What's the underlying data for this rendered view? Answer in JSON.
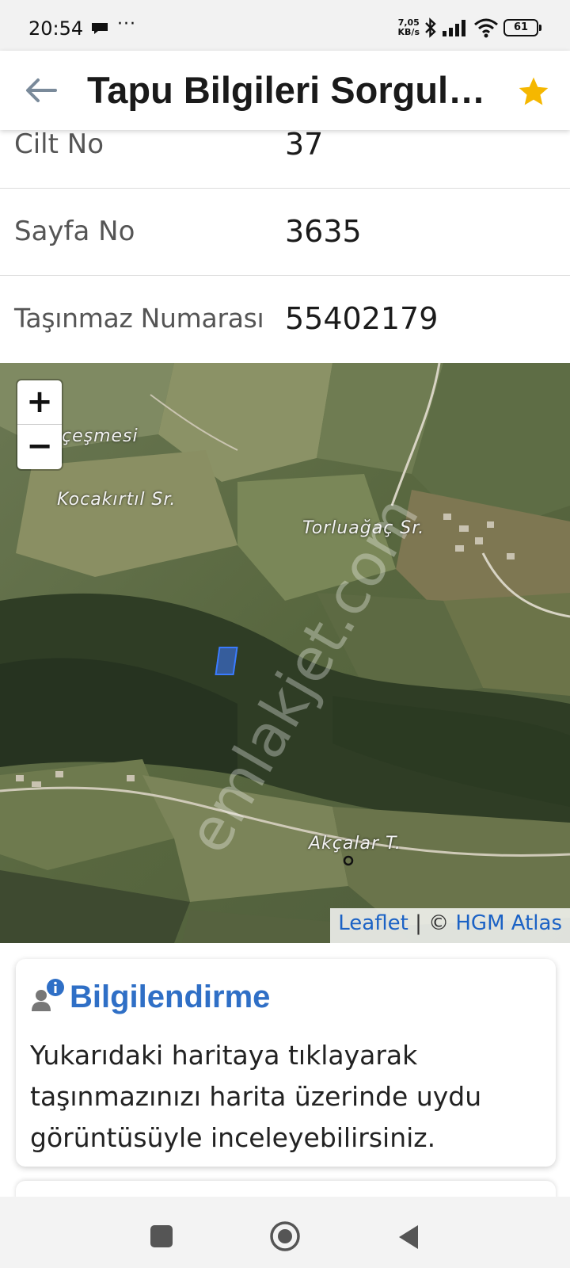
{
  "status_bar": {
    "time": "20:54",
    "dots": "···",
    "net_speed_value": "7,05",
    "net_speed_unit": "KB/s",
    "battery": "61"
  },
  "app_bar": {
    "title": "Tapu Bilgileri Sorgulama",
    "favorite_color": "#f5b700"
  },
  "info_rows": [
    {
      "label": "Cilt No",
      "value": "37"
    },
    {
      "label": "Sayfa No",
      "value": "3635"
    },
    {
      "label": "Taşınmaz Numarası",
      "value": "55402179"
    }
  ],
  "map": {
    "zoom_in": "+",
    "zoom_out": "−",
    "labels": {
      "cesmesi": "çeşmesi",
      "kocakirtil": "Kocakırtıl Sr.",
      "torluagac": "Torluağaç Sr.",
      "akcalar": "Akçalar T."
    },
    "watermark": "emlakjet.com",
    "attribution": {
      "leaflet": "Leaflet",
      "separator": " | © ",
      "provider": "HGM Atlas"
    }
  },
  "info_card": {
    "title": "Bilgilendirme",
    "body": "Yukarıdaki haritaya tıklayarak taşınmazınızı harita üzerinde uydu görüntüsüyle inceleyebilirsiniz.",
    "title_color": "#2f6fc6"
  }
}
